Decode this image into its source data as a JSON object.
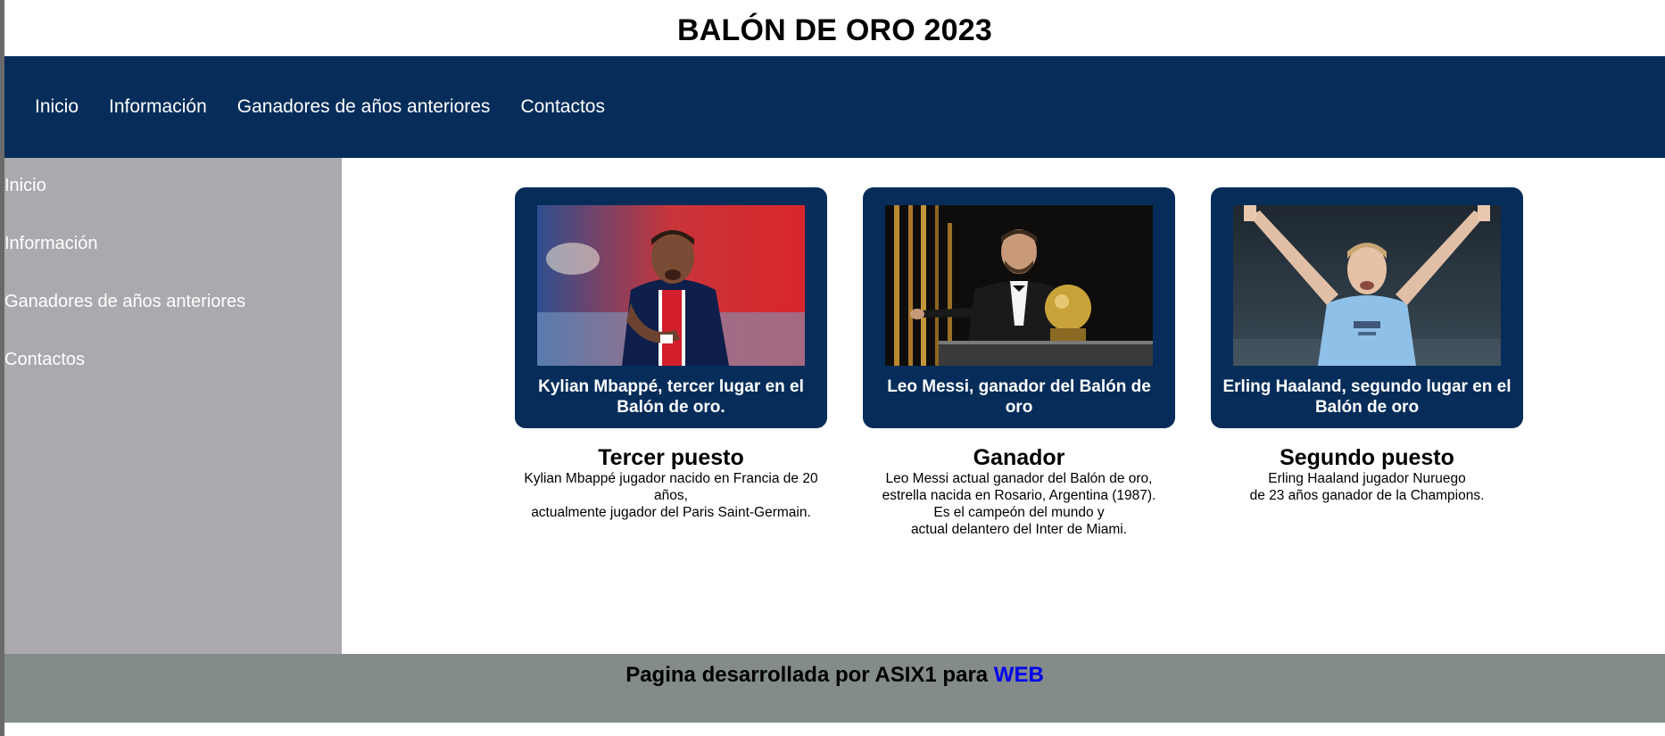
{
  "page_title": "BALÓN DE ORO 2023",
  "top_nav": [
    "Inicio",
    "Información",
    "Ganadores de años anteriores",
    "Contactos"
  ],
  "sidebar": [
    "Inicio",
    "Información",
    "Ganadores de años anteriores",
    "Contactos"
  ],
  "cards": [
    {
      "caption": "Kylian Mbappé, tercer lugar en el Balón de oro.",
      "title": "Tercer puesto",
      "description": [
        "Kylian Mbappé jugador nacido en Francia de 20 años,",
        "actualmente jugador del Paris Saint-Germain."
      ],
      "photo_icon": "player-photo-mbappe"
    },
    {
      "caption": "Leo Messi, ganador del Balón de oro",
      "title": "Ganador",
      "description": [
        "Leo Messi actual ganador del Balón de oro,",
        "estrella nacida en Rosario, Argentina (1987).",
        "Es el campeón del mundo y",
        "actual delantero del Inter de Miami."
      ],
      "photo_icon": "player-photo-messi"
    },
    {
      "caption": "Erling Haaland, segundo lugar en el Balón de oro",
      "title": "Segundo puesto",
      "description": [
        "Erling Haaland jugador Nuruego",
        "de 23 años ganador de la Champions."
      ],
      "photo_icon": "player-photo-haaland"
    }
  ],
  "footer": {
    "text": "Pagina desarrollada por ASIX1 para ",
    "link_label": "WEB"
  },
  "colors": {
    "nav_bg": "#062d5a",
    "sidebar_bg": "#aaa9ae",
    "footer_bg": "#848b8b",
    "link": "#0000ee"
  }
}
